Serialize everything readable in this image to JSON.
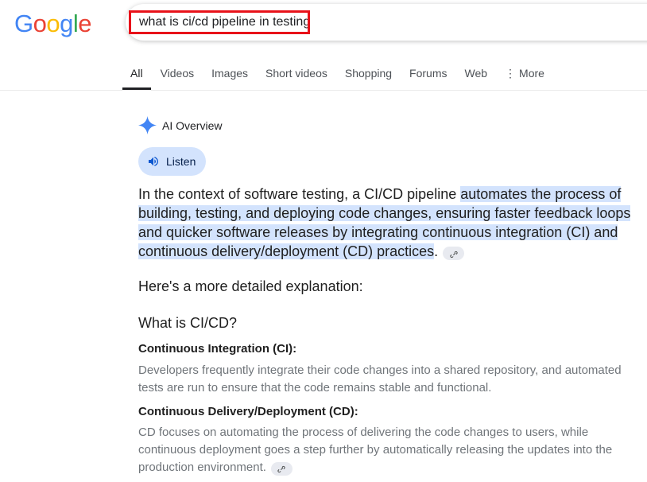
{
  "logo": {
    "text": "Google"
  },
  "search": {
    "query": "what is ci/cd pipeline in testing"
  },
  "tabs": [
    {
      "label": "All",
      "active": true
    },
    {
      "label": "Videos"
    },
    {
      "label": "Images"
    },
    {
      "label": "Short videos"
    },
    {
      "label": "Shopping"
    },
    {
      "label": "Forums"
    },
    {
      "label": "Web"
    },
    {
      "label": "More",
      "icon": "more-vert-icon"
    }
  ],
  "ai_overview": {
    "title": "AI Overview",
    "icon": "sparkle-icon",
    "listen_label": "Listen",
    "answer_plain": "In the context of software testing, a CI/CD pipeline ",
    "answer_highlight": "automates the process of building, testing, and deploying code changes, ensuring faster feedback loops and quicker software releases by integrating continuous integration (CI) and continuous delivery/deployment (CD) practices",
    "answer_end": ".",
    "detailed_intro": "Here's a more detailed explanation:",
    "section_heading": "What is CI/CD?",
    "items": [
      {
        "term": "Continuous Integration (CI):",
        "description": "Developers frequently integrate their code changes into a shared repository, and automated tests are run to ensure that the code remains stable and functional."
      },
      {
        "term": "Continuous Delivery/Deployment (CD):",
        "description": "CD focuses on automating the process of delivering the code changes to users, while continuous deployment goes a step further by automatically releasing the updates into the production environment."
      }
    ]
  },
  "colors": {
    "highlight": "#d3e3fd",
    "search_outline": "#e8121a",
    "sparkle": "#4285f4"
  }
}
